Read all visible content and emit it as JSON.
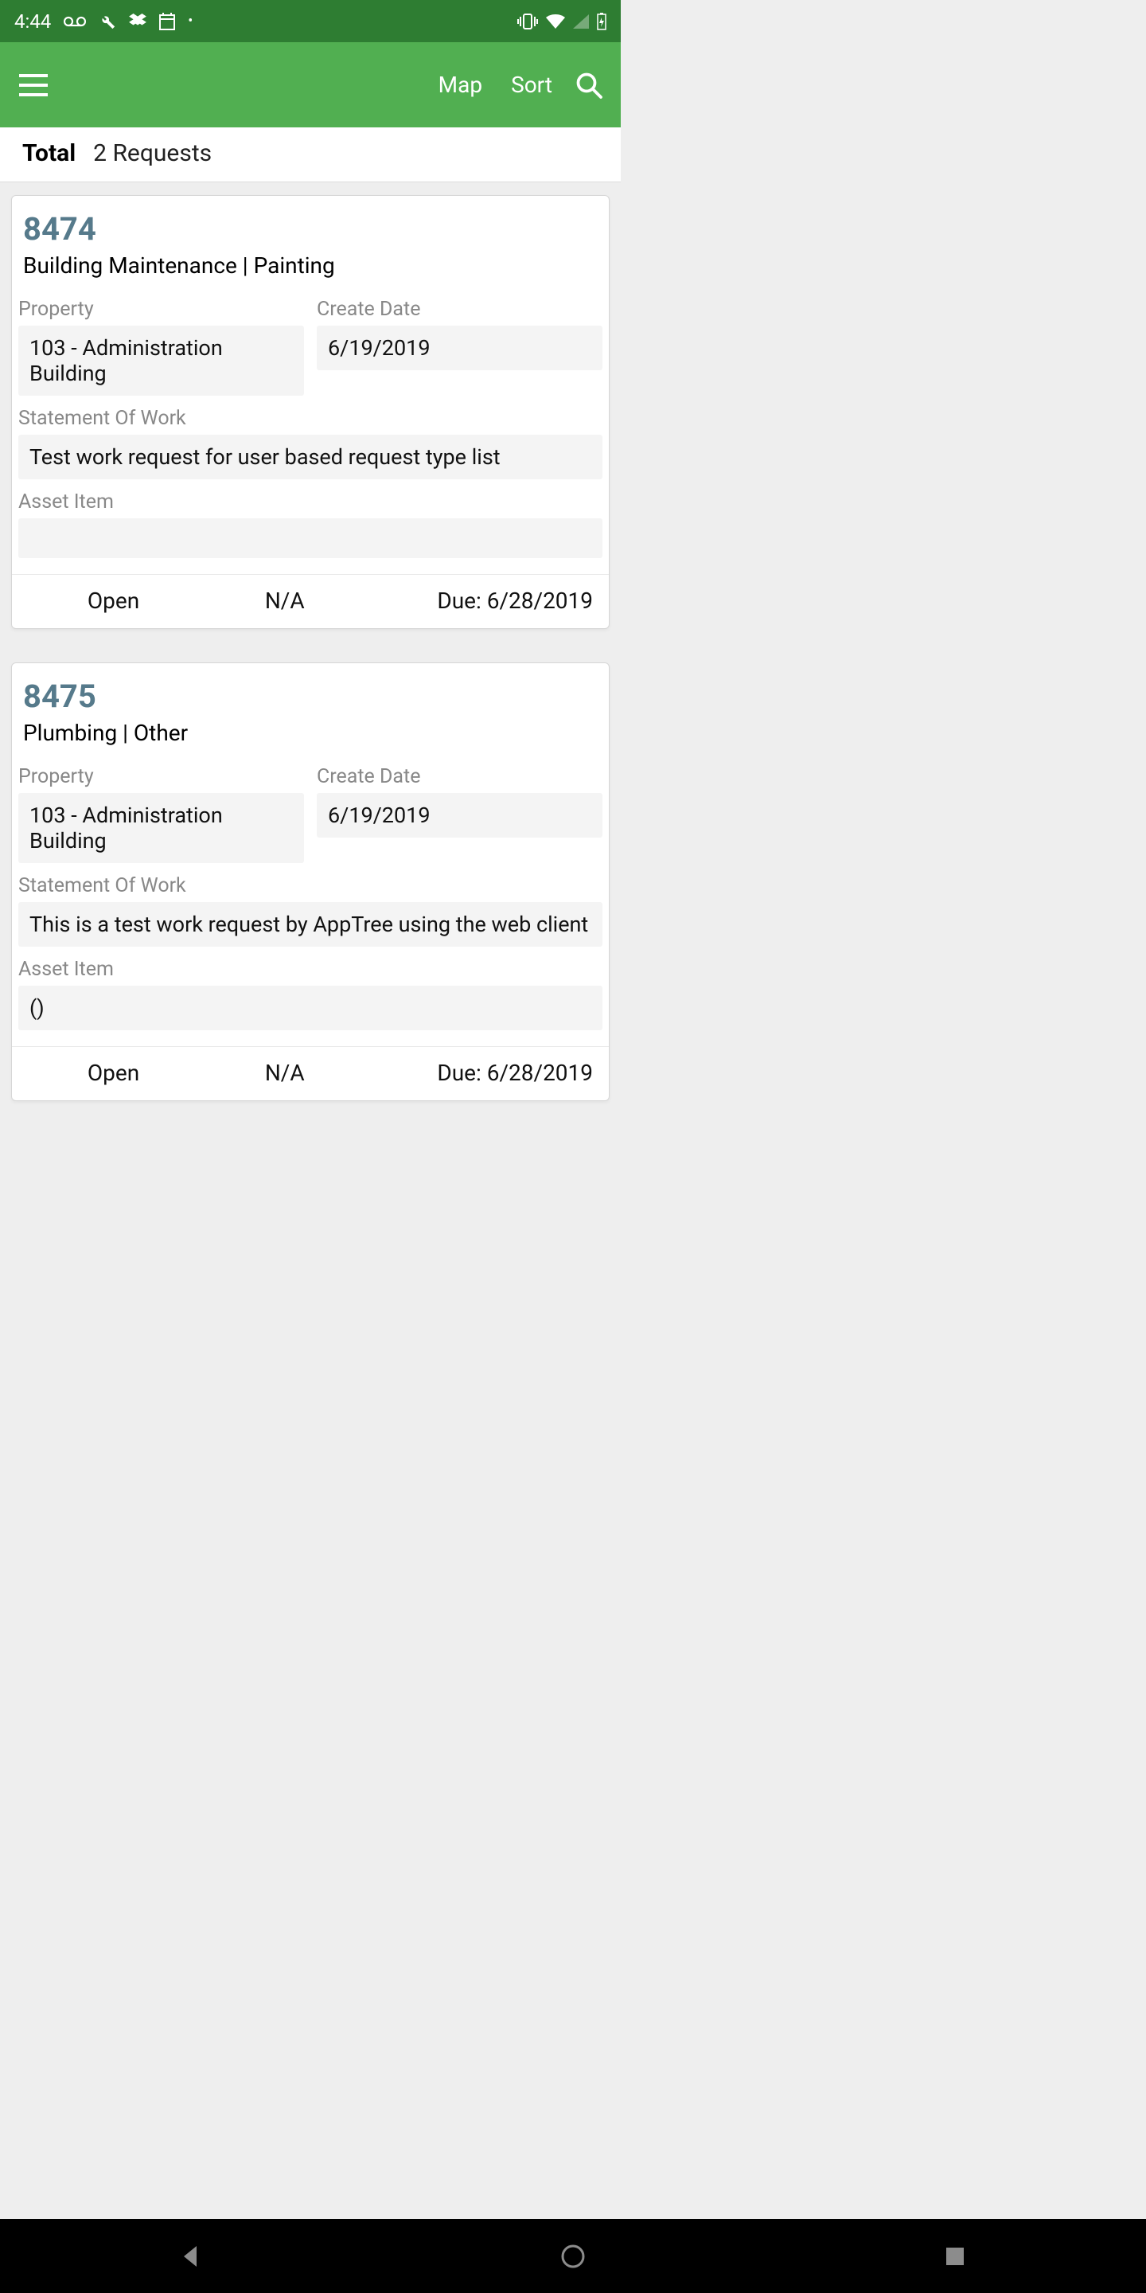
{
  "status": {
    "time": "4:44"
  },
  "appbar": {
    "map_label": "Map",
    "sort_label": "Sort"
  },
  "summary": {
    "label": "Total",
    "value": "2 Requests"
  },
  "labels": {
    "property": "Property",
    "create_date": "Create Date",
    "sow": "Statement Of Work",
    "asset_item": "Asset Item",
    "due_prefix": "Due: "
  },
  "requests": [
    {
      "id": "8474",
      "category": "Building Maintenance | Painting",
      "property": "103 - Administration Building",
      "create_date": "6/19/2019",
      "sow": "Test work request for user based request type list",
      "asset_item": "",
      "status": "Open",
      "priority": "N/A",
      "due": "6/28/2019"
    },
    {
      "id": "8475",
      "category": "Plumbing | Other",
      "property": "103 - Administration Building",
      "create_date": "6/19/2019",
      "sow": "This is a test work request by AppTree using the web client",
      "asset_item": "()",
      "status": "Open",
      "priority": "N/A",
      "due": "6/28/2019"
    }
  ]
}
